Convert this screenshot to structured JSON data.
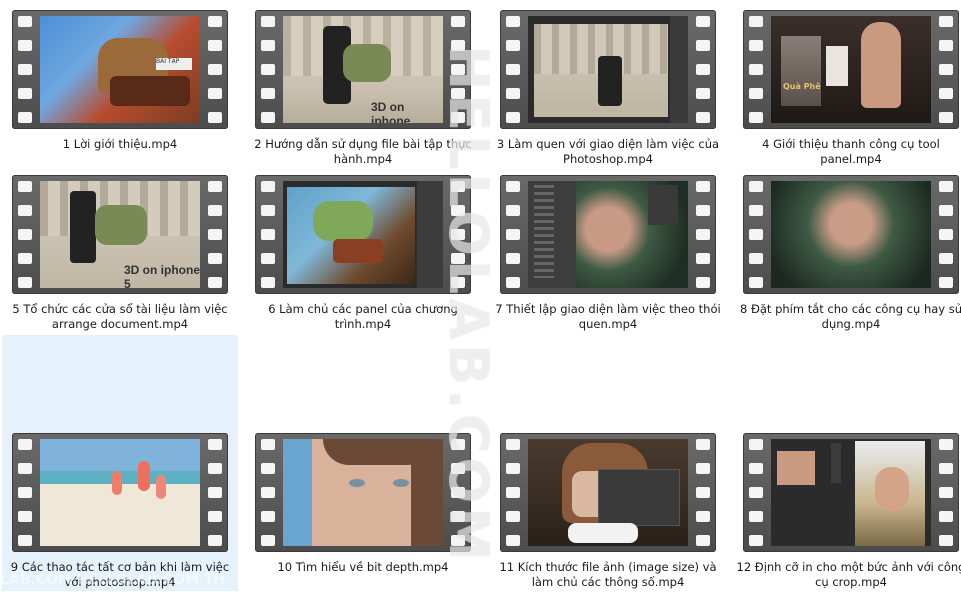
{
  "items": [
    {
      "label": "1 Lời giới thiệu.mp4"
    },
    {
      "label": "2 Hướng dẫn sử dụng file bài tập thực hành.mp4",
      "thumb_text": "3D on iphone"
    },
    {
      "label": "3 Làm quen với giao diện làm việc của Photoshop.mp4"
    },
    {
      "label": "4 Giới thiệu thanh công cụ tool panel.mp4",
      "thumb_text": "Quà Phê"
    },
    {
      "label": "5 Tổ chức các cửa sổ tài liệu làm việc arrange document.mp4",
      "thumb_text": "3D on iphone 5"
    },
    {
      "label": "6 Làm chủ các panel của chương trình.mp4"
    },
    {
      "label": "7 Thiết lập giao diện làm việc theo thói quen.mp4"
    },
    {
      "label": "8 Đặt phím tắt cho các công cụ hay sử dụng.mp4"
    },
    {
      "label": "9 Các thao tác tất cơ bản khi làm việc với photoshop.mp4"
    },
    {
      "label": "10 Tìm hiểu về bit depth.mp4"
    },
    {
      "label": "11 Kích thước file ảnh (image size) và làm chủ các thông số.mp4"
    },
    {
      "label": "12 Định cỡ in cho một bức ảnh với công cụ crop.mp4"
    }
  ],
  "watermark": "HELLOLAB.COM",
  "watermark_small": "LAB.COM  HELLOLAB.COM TH"
}
